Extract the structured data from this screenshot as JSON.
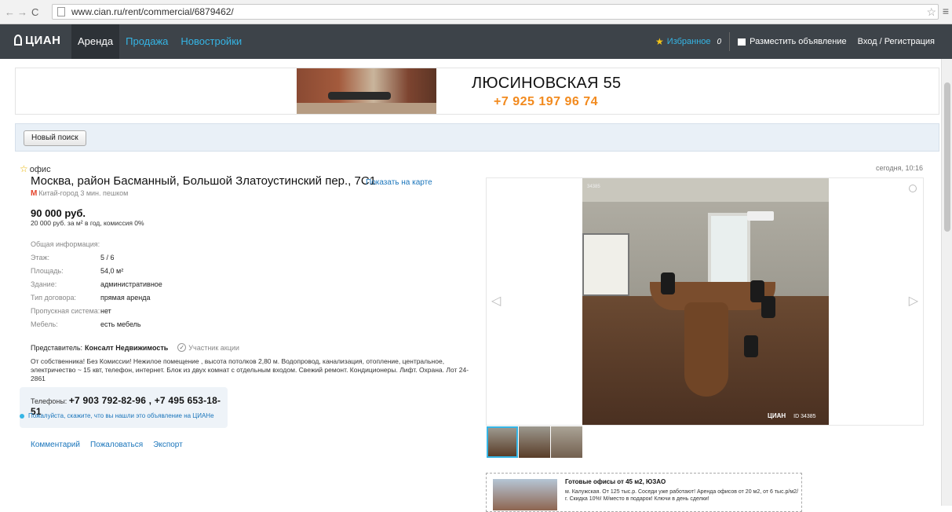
{
  "browser": {
    "url": "www.cian.ru/rent/commercial/6879462/"
  },
  "header": {
    "logo": "ЦИАН",
    "nav": [
      {
        "label": "Аренда",
        "active": true
      },
      {
        "label": "Продажа",
        "active": false
      },
      {
        "label": "Новостройки",
        "active": false
      }
    ],
    "favorites_label": "Избранное",
    "favorites_count": "0",
    "post_ad_label": "Разместить объявление",
    "login_label": "Вход / Регистрация"
  },
  "banner": {
    "title": "ЛЮСИНОВСКАЯ 55",
    "phone": "+7 925 197 96 74"
  },
  "search": {
    "new_search_label": "Новый поиск"
  },
  "listing": {
    "type": "офис",
    "date": "сегодня, 10:16",
    "address": "Москва, район Басманный, Большой Златоустинский пер., 7С1",
    "map_link": "Показать на карте",
    "metro": "Китай-город 3 мин. пешком",
    "price": "90 000 руб.",
    "price_sub": "20 000 руб. за м² в год, комиссия 0%",
    "info_title": "Общая информация:",
    "info": [
      {
        "key": "Этаж:",
        "value": "5 / 6"
      },
      {
        "key": "Площадь:",
        "value": "54,0 м²"
      },
      {
        "key": "Здание:",
        "value": "административное"
      },
      {
        "key": "Тип договора:",
        "value": "прямая аренда"
      },
      {
        "key": "Пропускная система:",
        "value": "нет"
      },
      {
        "key": "Мебель:",
        "value": "есть мебель"
      }
    ],
    "agent_label": "Представитель:",
    "agent_name": "Консалт Недвижимость",
    "promo_label": "Участник акции",
    "description": "От собственника! Без Комиссии! Нежилое помещение , высота потолков 2,80 м. Водопровод, канализация, отопление, центральное, электричество ~ 15 квт, телефон, интернет. Блок из двух комнат с отдельным входом. Свежий ремонт. Кондиционеры. Лифт. Охрана. Лот 24-2861",
    "phones_label": "Телефоны:",
    "phones": "+7 903 792-82-96 , +7 495 653-18-51",
    "phone_note": "Пожалуйста, скажите, что вы нашли это объявление на ЦИАНе",
    "actions": [
      "Комментарий",
      "Пожаловаться",
      "Экспорт"
    ]
  },
  "gallery": {
    "photo_id": "34385",
    "watermark_logo": "ЦИАН",
    "watermark_id": "ID 34385"
  },
  "ad": {
    "title": "Готовые офисы от 45 м2, ЮЗАО",
    "text": "м. Калужская. От 125 тыс.р. Соседи уже работают! Аренда офисов от 20 м2, от 6 тыс.р/м2/г. Скидка 10%! М/место в подарок! Ключи в день сделки!"
  }
}
